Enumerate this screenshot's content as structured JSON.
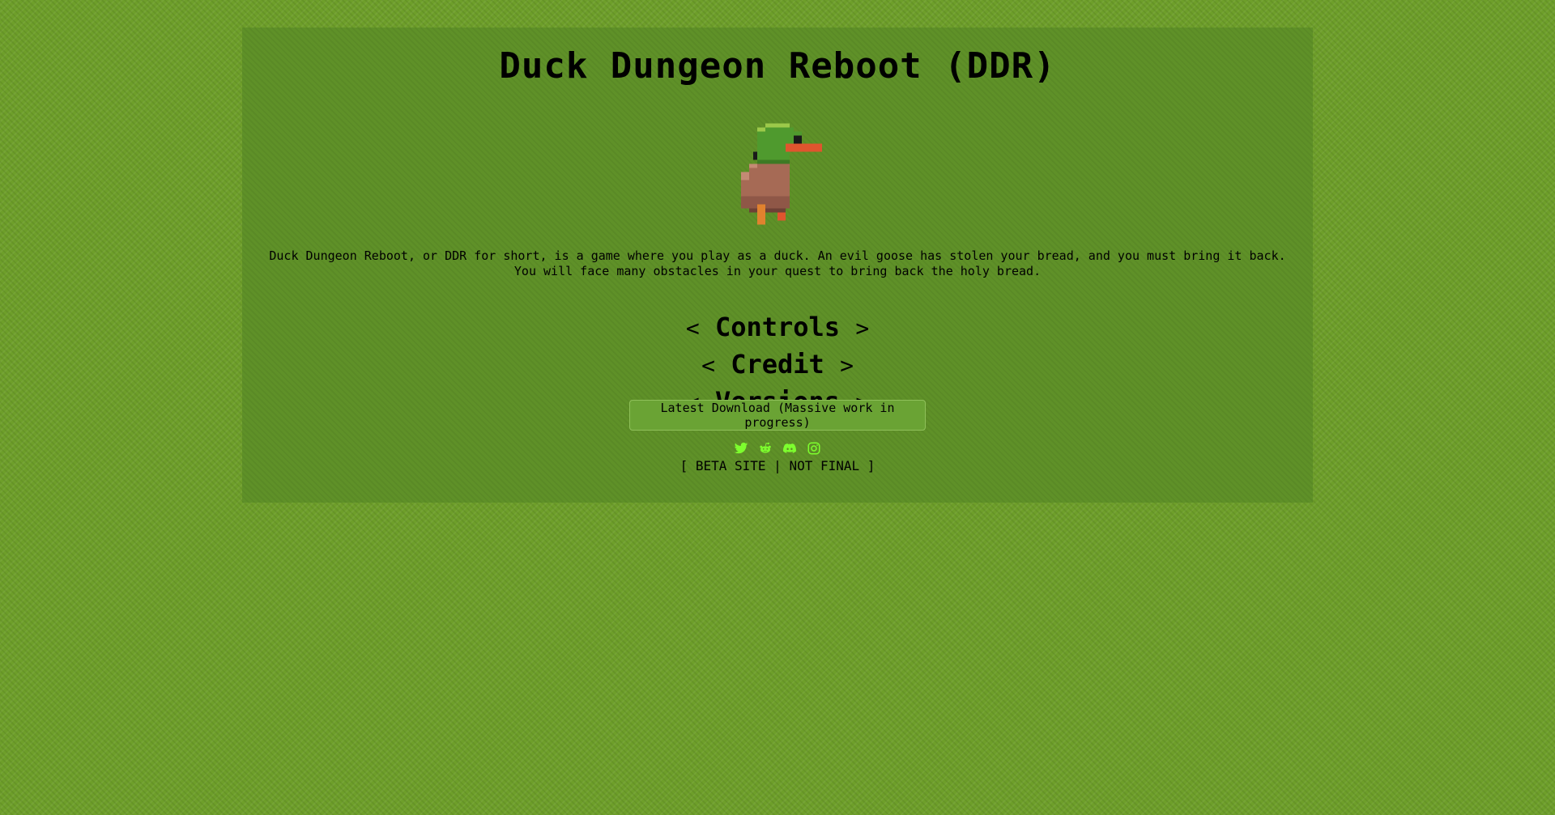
{
  "page": {
    "title": "Duck Dungeon Reboot (DDR)",
    "description": "Duck Dungeon Reboot, or DDR for short, is a game where you play as a duck. An evil goose has stolen your bread, and you must bring it back. You will face many obstacles in your quest to bring back the holy bread.",
    "logo_icon": "duck-sprite"
  },
  "sections": [
    {
      "left": "<",
      "label": "Controls",
      "right": ">"
    },
    {
      "left": "<",
      "label": "Credit",
      "right": ">"
    },
    {
      "left": "<",
      "label": "Versions",
      "right": ">"
    }
  ],
  "download": {
    "label": "Latest Download (Massive work in progress)"
  },
  "socials": [
    {
      "icon": "twitter-icon"
    },
    {
      "icon": "reddit-icon"
    },
    {
      "icon": "discord-icon"
    },
    {
      "icon": "instagram-icon"
    }
  ],
  "footer": {
    "note": "[ BETA SITE | NOT FINAL ]"
  },
  "colors": {
    "background": "#6e9f2a",
    "panel": "#5f9128",
    "social_icon": "#7dff2e"
  }
}
